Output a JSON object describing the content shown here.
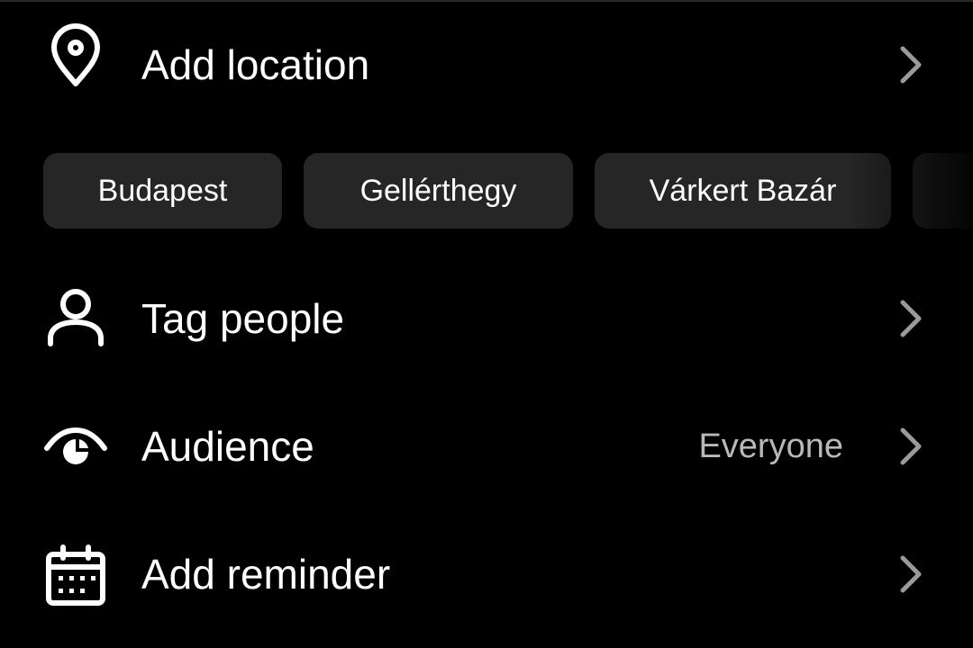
{
  "location": {
    "label": "Add location",
    "icon": "location-pin-icon",
    "chevron_icon": "chevron-right-icon"
  },
  "suggested_locations": [
    {
      "label": "Budapest"
    },
    {
      "label": "Gellérthegy"
    },
    {
      "label": "Várkert Bazár"
    },
    {
      "label": ""
    }
  ],
  "tag_people": {
    "label": "Tag people",
    "icon": "person-icon",
    "chevron_icon": "chevron-right-icon"
  },
  "audience": {
    "label": "Audience",
    "value": "Everyone",
    "icon": "eye-icon",
    "chevron_icon": "chevron-right-icon"
  },
  "reminder": {
    "label": "Add reminder",
    "icon": "calendar-icon",
    "chevron_icon": "chevron-right-icon"
  },
  "colors": {
    "background": "#000000",
    "text": "#ffffff",
    "secondary_text": "#b8b8b8",
    "chip_background": "#262626",
    "chevron": "#9a9a9a"
  }
}
